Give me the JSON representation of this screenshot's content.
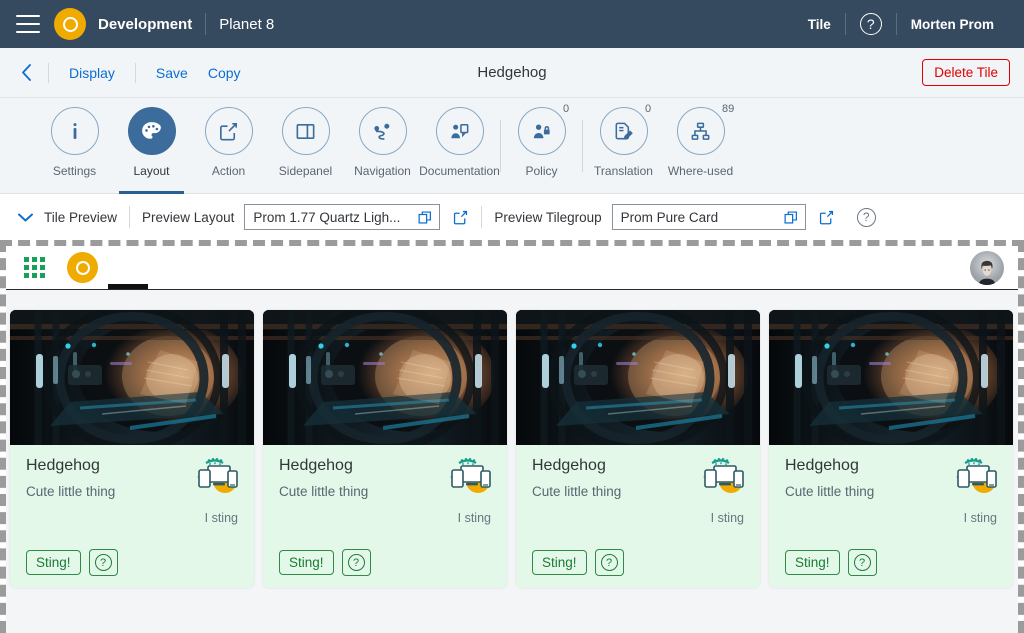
{
  "shell": {
    "menu_icon": "hamburger-icon",
    "logo_icon": "brand-logo-icon",
    "title": "Development",
    "subtitle": "Planet 8",
    "right_item": "Tile",
    "help_icon": "help-icon",
    "user": "Morten Prom"
  },
  "titlebar": {
    "back_icon": "back-chevron-icon",
    "links": [
      "Display",
      "Save",
      "Copy"
    ],
    "center_title": "Hedgehog",
    "delete_label": "Delete Tile"
  },
  "icon_tabs": [
    {
      "label": "Settings",
      "icon": "info-icon",
      "badge": "",
      "active": false
    },
    {
      "label": "Layout",
      "icon": "palette-icon",
      "badge": "",
      "active": true
    },
    {
      "label": "Action",
      "icon": "share-action-icon",
      "badge": "",
      "active": false
    },
    {
      "label": "Sidepanel",
      "icon": "sidepanel-icon",
      "badge": "",
      "active": false
    },
    {
      "label": "Navigation",
      "icon": "route-pin-icon",
      "badge": "",
      "active": false
    },
    {
      "label": "Documentation",
      "icon": "person-doc-icon",
      "badge": "",
      "active": false
    },
    {
      "label": "Policy",
      "icon": "person-lock-icon",
      "badge": "0",
      "active": false
    },
    {
      "label": "Translation",
      "icon": "doc-pencil-icon",
      "badge": "0",
      "active": false
    },
    {
      "label": "Where-used",
      "icon": "hierarchy-icon",
      "badge": "89",
      "active": false
    }
  ],
  "preview_bar": {
    "collapse_icon": "chevron-down-icon",
    "section_label": "Tile Preview",
    "layout_label": "Preview Layout",
    "layout_value": "Prom 1.77 Quartz Ligh...",
    "layout_vh_icon": "value-help-icon",
    "layout_open_icon": "open-external-icon",
    "tilegroup_label": "Preview Tilegroup",
    "tilegroup_value": "Prom Pure Card",
    "tilegroup_vh_icon": "value-help-icon",
    "tilegroup_open_icon": "open-external-icon",
    "help_icon": "help-icon"
  },
  "preview_canvas": {
    "fiori_bar": {
      "grid_icon": "app-grid-icon",
      "logo_icon": "brand-logo-icon",
      "avatar": "user-avatar"
    },
    "cards": [
      {
        "title": "Hedgehog",
        "subtitle": "Cute little thing",
        "note": "I sting",
        "action_label": "Sting!",
        "help_icon": "help-icon",
        "media_icon": "devices-illustration-icon"
      },
      {
        "title": "Hedgehog",
        "subtitle": "Cute little thing",
        "note": "I sting",
        "action_label": "Sting!",
        "help_icon": "help-icon",
        "media_icon": "devices-illustration-icon"
      },
      {
        "title": "Hedgehog",
        "subtitle": "Cute little thing",
        "note": "I sting",
        "action_label": "Sting!",
        "help_icon": "help-icon",
        "media_icon": "devices-illustration-icon"
      },
      {
        "title": "Hedgehog",
        "subtitle": "Cute little thing",
        "note": "I sting",
        "action_label": "Sting!",
        "help_icon": "help-icon",
        "media_icon": "devices-illustration-icon"
      }
    ]
  },
  "colors": {
    "shell_bg": "#354a5f",
    "accent_orange": "#f0ab00",
    "link_blue": "#0a6ed1",
    "active_tab": "#3b6c9b",
    "delete_red": "#e00000",
    "card_green": "#e3f8e8",
    "card_green_text": "#1d7a37",
    "grid_green": "#17a05a"
  }
}
